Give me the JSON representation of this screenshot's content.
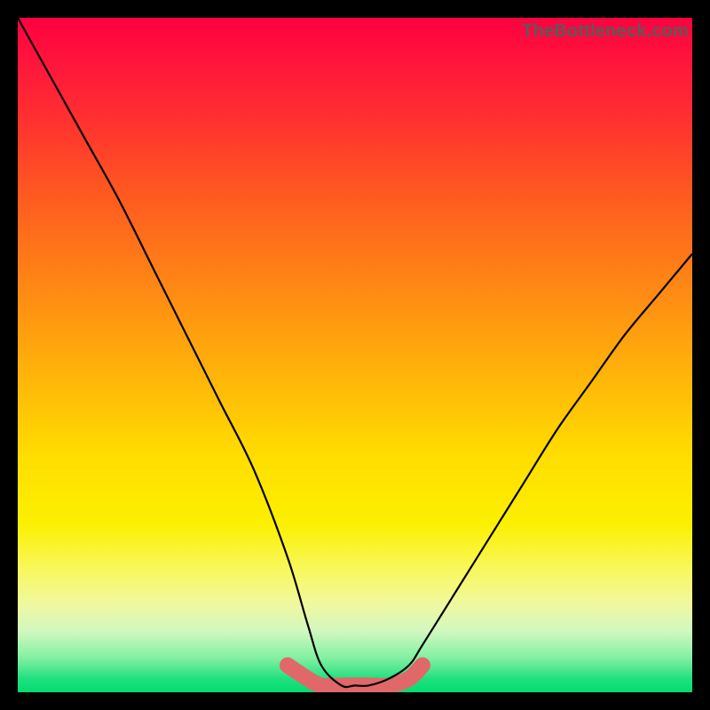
{
  "watermark": "TheBottleneck.com",
  "chart_data": {
    "type": "line",
    "title": "",
    "xlabel": "",
    "ylabel": "",
    "xlim": [
      0,
      100
    ],
    "ylim": [
      0,
      100
    ],
    "series": [
      {
        "name": "bottleneck-curve",
        "x": [
          0,
          5,
          10,
          15,
          20,
          25,
          30,
          35,
          40,
          43,
          45,
          48,
          50,
          52,
          55,
          58,
          60,
          65,
          70,
          75,
          80,
          85,
          90,
          95,
          100
        ],
        "y": [
          100,
          91,
          82,
          73,
          63,
          53,
          43,
          33,
          20,
          10,
          4,
          1,
          1,
          1,
          2,
          4,
          7,
          15,
          23,
          31,
          39,
          46,
          53,
          59,
          65
        ]
      },
      {
        "name": "highlight-band",
        "x": [
          40,
          43,
          45,
          48,
          50,
          52,
          55,
          58,
          60
        ],
        "y": [
          4,
          2,
          1,
          1,
          1,
          1,
          1,
          2,
          4
        ]
      }
    ],
    "colors": {
      "curve": "#000000",
      "highlight": "#e06868"
    }
  }
}
